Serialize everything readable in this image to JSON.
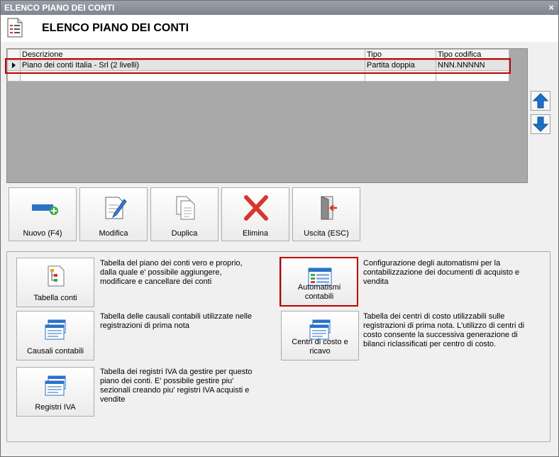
{
  "window": {
    "title": "ELENCO PIANO DEI CONTI",
    "close": "×"
  },
  "header": {
    "title": "ELENCO PIANO DEI CONTI"
  },
  "grid": {
    "columns": [
      "Descrizione",
      "Tipo",
      "Tipo codifica"
    ],
    "rows": [
      {
        "descrizione": "Piano dei conti Italia - Srl (2 livelli)",
        "tipo": "Partita doppia",
        "tipo_codifica": "NNN.NNNNN"
      }
    ]
  },
  "toolbar": {
    "nuovo": "Nuovo (F4)",
    "modifica": "Modifica",
    "duplica": "Duplica",
    "elimina": "Elimina",
    "uscita": "Uscita (ESC)"
  },
  "functions": {
    "tabella_conti": {
      "label": "Tabella conti",
      "desc": "Tabella del piano dei conti vero e proprio, dalla quale e' possibile aggiungere, modificare e cancellare dei conti"
    },
    "automatismi": {
      "label": "Automatismi contabili",
      "desc": "Configurazione degli automatismi per la contabilizzazione dei documenti di acquisto e vendita"
    },
    "causali": {
      "label": "Causali contabili",
      "desc": "Tabella delle causali contabili utilizzate nelle registrazioni di prima nota"
    },
    "centri": {
      "label": "Centri di costo e ricavo",
      "desc": "Tabella dei centri di costo utilizzabili sulle registrazioni di prima nota. L'utilizzo di centri di costo consente la successiva generazione di bilanci riclassificati per centro di costo."
    },
    "registri": {
      "label": "Registri IVA",
      "desc": "Tabella dei registri IVA da gestire per questo piano dei conti. E' possibile gestire piu' sezionali creando piu' registri IVA acquisti e vendite"
    }
  },
  "colors": {
    "highlight": "#c00000",
    "accent_blue": "#1c6fc7"
  }
}
